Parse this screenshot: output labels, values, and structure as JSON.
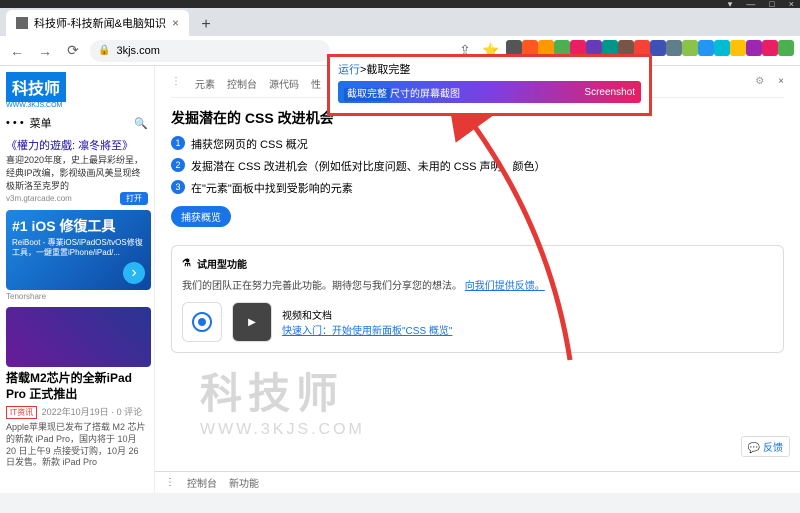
{
  "window": {
    "min": "—",
    "max": "□",
    "close": "×",
    "down": "▾"
  },
  "tab": {
    "title": "科技师-科技新闻&电脑知识",
    "close": "×",
    "plus": "+"
  },
  "toolbar": {
    "back": "←",
    "fwd": "→",
    "reload": "⟳",
    "lock": "🔒",
    "url": "3kjs.com",
    "share": "⇪",
    "star": "⭐"
  },
  "ext_colors": [
    "#555",
    "#ff5722",
    "#ff9800",
    "#4caf50",
    "#e91e63",
    "#673ab7",
    "#009688",
    "#795548",
    "#f44336",
    "#3f51b5",
    "#607d8b",
    "#8bc34a",
    "#2196f3",
    "#00bcd4",
    "#ffc107",
    "#9c27b0",
    "#e91e63",
    "#4caf50"
  ],
  "sidebar": {
    "logo": "科技师",
    "logo_sub": "WWW.3KJS.COM",
    "menu": "菜单",
    "search": "🔍",
    "promo1_title": "《權力的遊戲: 凛冬將至》",
    "promo1_desc": "喜迎2020年度，史上最异彩纷呈，经典IP改编，影视级画风美显现终极斯洛至克罗的",
    "promo1_src": "v3m.gtarcade.com",
    "promo1_btn": "打开",
    "banner_title": "#1 iOS 修復工具",
    "banner_sub": "ReiBoot - 專業iOS/iPadOS/tvOS修復工具，一鍵重置iPhone/iPad/...",
    "banner_src": "Tenorshare",
    "article_title": "搭载M2芯片的全新iPad Pro 正式推出",
    "article_cat": "IT资讯",
    "article_meta": "2022年10月19日 · 0 评论",
    "article_body": "Apple苹果现已发布了搭载 M2 芯片的新款 iPad Pro，国内将于 10月 20 日上午9 点接受订购，10月 26 日发售。新款 iPad Pro"
  },
  "devtools": {
    "tabs": [
      "元素",
      "控制台",
      "源代码",
      "性",
      "…",
      "…",
      "…",
      "…",
      "…",
      "…"
    ],
    "close": "×"
  },
  "content": {
    "heading": "发掘潜在的 CSS 改进机会",
    "items": [
      "捕获您网页的 CSS 概况",
      "发掘潜在 CSS 改进机会（例如低对比度问题、未用的 CSS 声明、颜色）",
      "在\"元素\"面板中找到受影响的元素"
    ],
    "capture_btn": "捕获概览",
    "card_title": "试用型功能",
    "card_body": "我们的团队正在努力完善此功能。期待您与我们分享您的想法。",
    "card_link": "向我们提供反馈。",
    "media_label": "视频和文档",
    "media_link": "快速入门：开始使用新面板\"CSS 概览\"",
    "feedback": "💬 反馈",
    "bottom_tabs": [
      "控制台",
      "新功能"
    ]
  },
  "callout": {
    "run": "运行",
    "cmd": ">截取完整",
    "row_sel": "截取完整",
    "row_rest": "尺寸的屏幕截图",
    "btn": "Screenshot"
  },
  "watermark": {
    "l1": "科技师",
    "l2": "WWW.3KJS.COM"
  }
}
